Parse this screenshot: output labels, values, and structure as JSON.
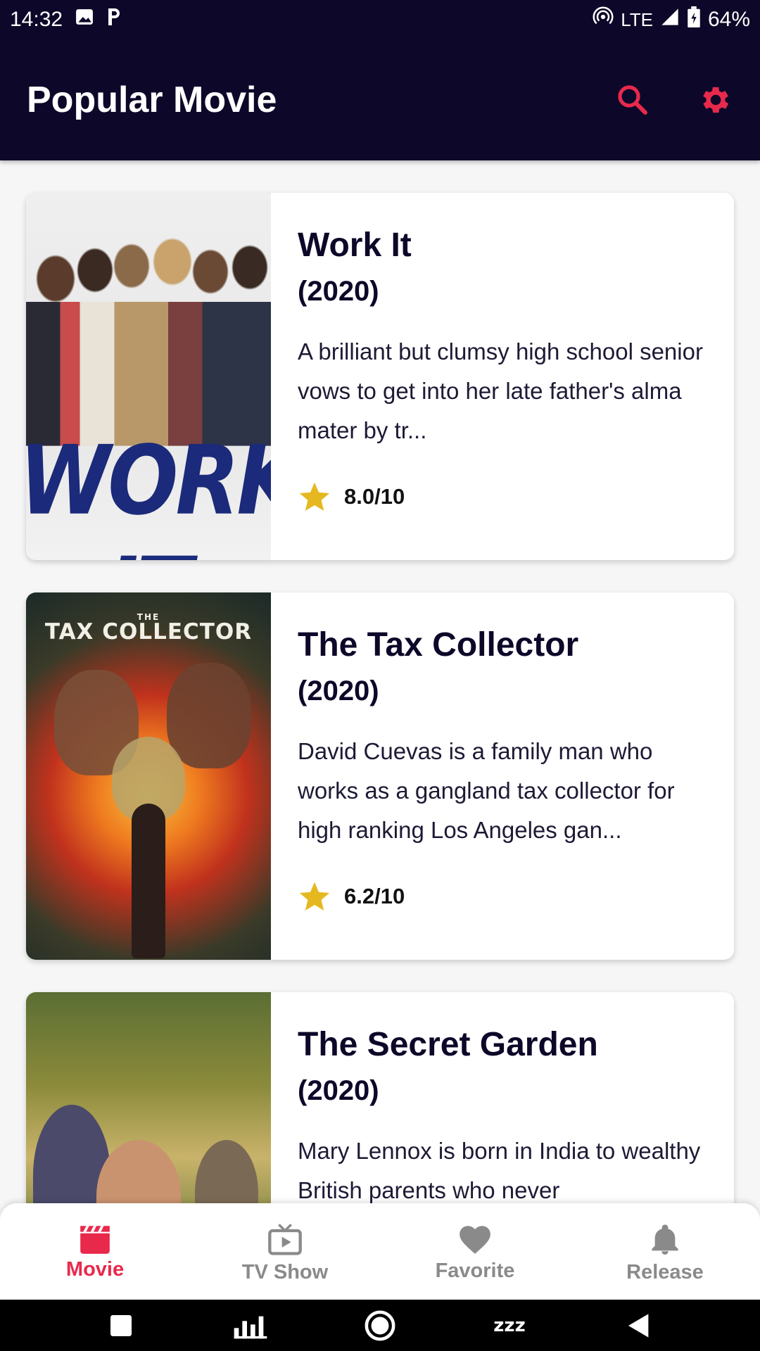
{
  "status_bar": {
    "time": "14:32",
    "network": "LTE",
    "battery": "64%"
  },
  "app_bar": {
    "title": "Popular Movie",
    "actions": [
      {
        "name": "search-icon",
        "color": "#e8294c"
      },
      {
        "name": "gear-icon",
        "color": "#e8294c"
      }
    ]
  },
  "movies": [
    {
      "title": "Work It",
      "year": "(2020)",
      "overview": "A brilliant but clumsy high school senior vows to get into her late father's alma mater by tr...",
      "rating": "8.0/10",
      "poster_text": "WORK IT"
    },
    {
      "title": "The Tax Collector",
      "year": "(2020)",
      "overview": "David Cuevas is a family man who works as a gangland tax collector for high ranking Los Angeles gan...",
      "rating": "6.2/10",
      "poster_text_small": "THE",
      "poster_text": "TAX COLLECTOR"
    },
    {
      "title": "The Secret Garden",
      "year": "(2020)",
      "overview": "Mary Lennox is born in India to wealthy British parents who never"
    }
  ],
  "bottom_nav": {
    "items": [
      {
        "label": "Movie",
        "icon": "clapperboard-icon",
        "active": true
      },
      {
        "label": "TV Show",
        "icon": "tv-icon",
        "active": false
      },
      {
        "label": "Favorite",
        "icon": "heart-icon",
        "active": false
      },
      {
        "label": "Release",
        "icon": "bell-icon",
        "active": false
      }
    ]
  },
  "system_nav": {
    "zzz": "zzz"
  },
  "colors": {
    "primary_dark": "#0d0829",
    "accent": "#e8294c",
    "star": "#e6b820",
    "inactive": "#8a8a8a"
  }
}
